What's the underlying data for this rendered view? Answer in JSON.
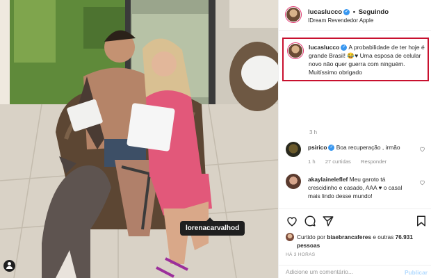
{
  "post": {
    "tagged_user": "lorenacarvalhod"
  },
  "header": {
    "username": "lucaslucco",
    "separator": "•",
    "follow_status": "Seguindo",
    "location": "IDream Revendedor Apple"
  },
  "caption": {
    "username": "lucaslucco",
    "text": "A probabilidade de ter hoje é grande Brasil! 😂♥ Uma esposa de celular novo não quer guerra com ninguém. Muitíssimo obrigado"
  },
  "caption_time": "3 h",
  "comments": [
    {
      "username": "psirico",
      "text": "Boa recuperação , irmão",
      "time": "1 h",
      "likes": "27 curtidas",
      "reply": "Responder"
    },
    {
      "username": "akaylaineleflef",
      "text": "Meu garoto tá crescidinho e casado, AAA ♥ o casal mais lindo desse mundo!"
    }
  ],
  "liked_by": {
    "prefix": "Curtido por",
    "user": "biaebrancaferes",
    "middle": "e outras",
    "count": "76.931",
    "suffix": "pessoas"
  },
  "post_time": "HÁ 3 HORAS",
  "add_comment": {
    "placeholder": "Adicione um comentário...",
    "publish_label": "Publicar"
  },
  "icons": [
    "heart-icon",
    "comment-icon",
    "share-icon",
    "bookmark-icon",
    "verified-icon",
    "tag-user-icon"
  ],
  "colors": {
    "verified": "#3897f0",
    "highlight_border": "#c8102e",
    "publish_disabled": "#b3dbff",
    "muted": "#8e8e8e"
  }
}
